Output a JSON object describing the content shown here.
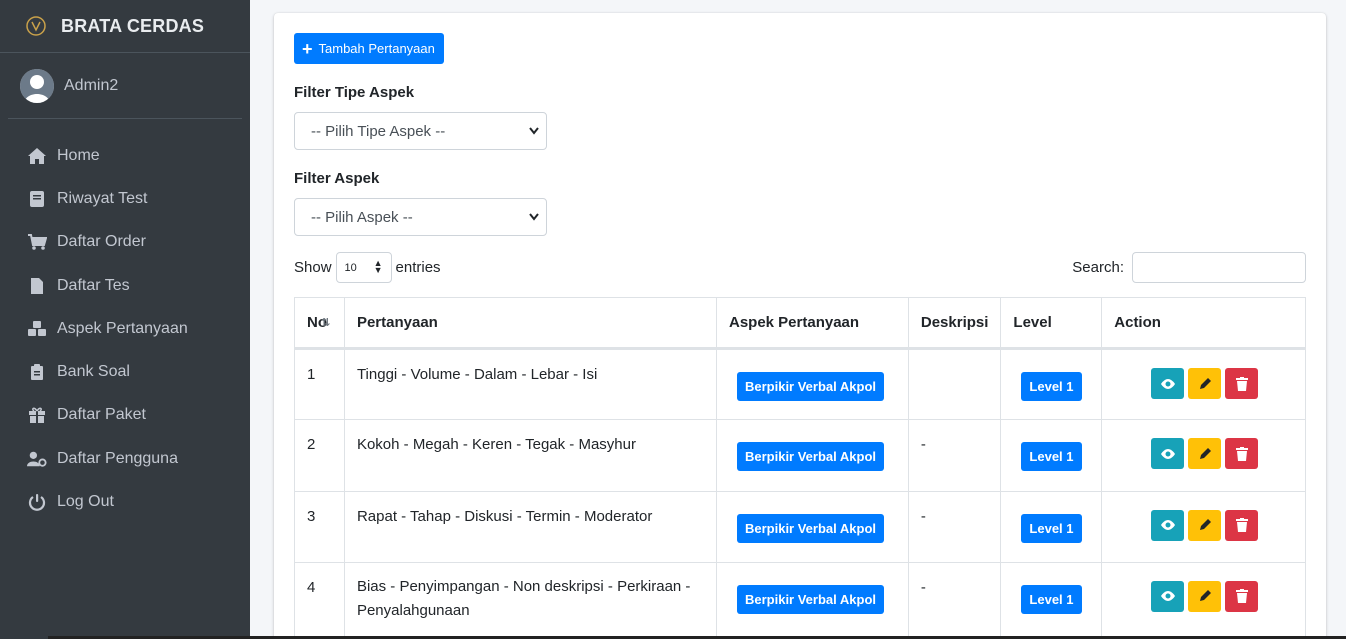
{
  "brand": {
    "name": "BRATA CERDAS"
  },
  "user": {
    "name": "Admin2"
  },
  "sidebar": {
    "items": [
      {
        "label": "Home",
        "icon": "home-icon"
      },
      {
        "label": "Riwayat Test",
        "icon": "book-icon"
      },
      {
        "label": "Daftar Order",
        "icon": "cart-icon"
      },
      {
        "label": "Daftar Tes",
        "icon": "file-icon"
      },
      {
        "label": "Aspek Pertanyaan",
        "icon": "cubes-icon"
      },
      {
        "label": "Bank Soal",
        "icon": "clipboard-icon"
      },
      {
        "label": "Daftar Paket",
        "icon": "gift-icon"
      },
      {
        "label": "Daftar Pengguna",
        "icon": "users-cog-icon"
      },
      {
        "label": "Log Out",
        "icon": "power-icon"
      }
    ]
  },
  "main": {
    "add_button": "Tambah Pertanyaan",
    "filter_tipe_label": "Filter Tipe Aspek",
    "filter_tipe_value": "-- Pilih Tipe Aspek --",
    "filter_aspek_label": "Filter Aspek",
    "filter_aspek_value": "-- Pilih Aspek --",
    "show_label": "Show",
    "entries_value": "10",
    "entries_label": "entries",
    "search_label": "Search:",
    "search_value": ""
  },
  "table": {
    "headers": [
      "No",
      "Pertanyaan",
      "Aspek Pertanyaan",
      "Deskripsi",
      "Level",
      "Action"
    ],
    "rows": [
      {
        "no": "1",
        "pertanyaan": "Tinggi - Volume - Dalam - Lebar - Isi",
        "aspek": "Berpikir Verbal Akpol",
        "deskripsi": "",
        "level": "Level 1"
      },
      {
        "no": "2",
        "pertanyaan": "Kokoh - Megah - Keren - Tegak - Masyhur",
        "aspek": "Berpikir Verbal Akpol",
        "deskripsi": "-",
        "level": "Level 1"
      },
      {
        "no": "3",
        "pertanyaan": "Rapat - Tahap - Diskusi - Termin - Moderator",
        "aspek": "Berpikir Verbal Akpol",
        "deskripsi": "-",
        "level": "Level 1"
      },
      {
        "no": "4",
        "pertanyaan": "Bias - Penyimpangan - Non deskripsi - Perkiraan - Penyalahgunaan",
        "aspek": "Berpikir Verbal Akpol",
        "deskripsi": "-",
        "level": "Level 1"
      }
    ]
  },
  "colors": {
    "sidebar": "#343a40",
    "primary": "#007bff",
    "info": "#17a2b8",
    "warning": "#ffc107",
    "danger": "#dc3545"
  }
}
